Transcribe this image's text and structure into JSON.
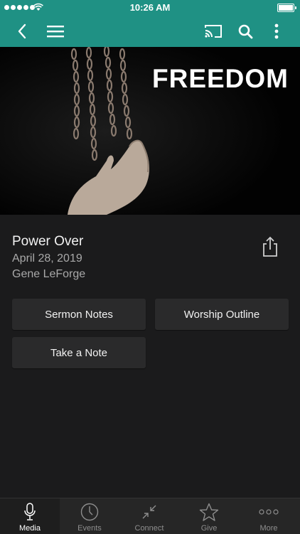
{
  "status_bar": {
    "time": "10:26 AM"
  },
  "toolbar": {
    "back_icon": "chevron-left-icon",
    "menu_icon": "hamburger-icon",
    "cast_icon": "cast-icon",
    "search_icon": "search-icon",
    "more_icon": "more-vertical-icon"
  },
  "hero": {
    "series_title": "FREEDOM"
  },
  "sermon": {
    "title": "Power Over",
    "date": "April 28, 2019",
    "speaker": "Gene LeForge",
    "share_icon": "share-icon"
  },
  "actions": {
    "sermon_notes": "Sermon Notes",
    "worship_outline": "Worship Outline",
    "take_note": "Take a Note"
  },
  "tabs": [
    {
      "label": "Media",
      "icon": "microphone-icon",
      "active": true
    },
    {
      "label": "Events",
      "icon": "clock-icon",
      "active": false
    },
    {
      "label": "Connect",
      "icon": "connect-icon",
      "active": false
    },
    {
      "label": "Give",
      "icon": "star-icon",
      "active": false
    },
    {
      "label": "More",
      "icon": "more-dots-icon",
      "active": false
    }
  ],
  "colors": {
    "accent": "#1f9184",
    "background": "#1b1b1c",
    "button": "#2a2a2b",
    "tabbar": "#262626"
  }
}
